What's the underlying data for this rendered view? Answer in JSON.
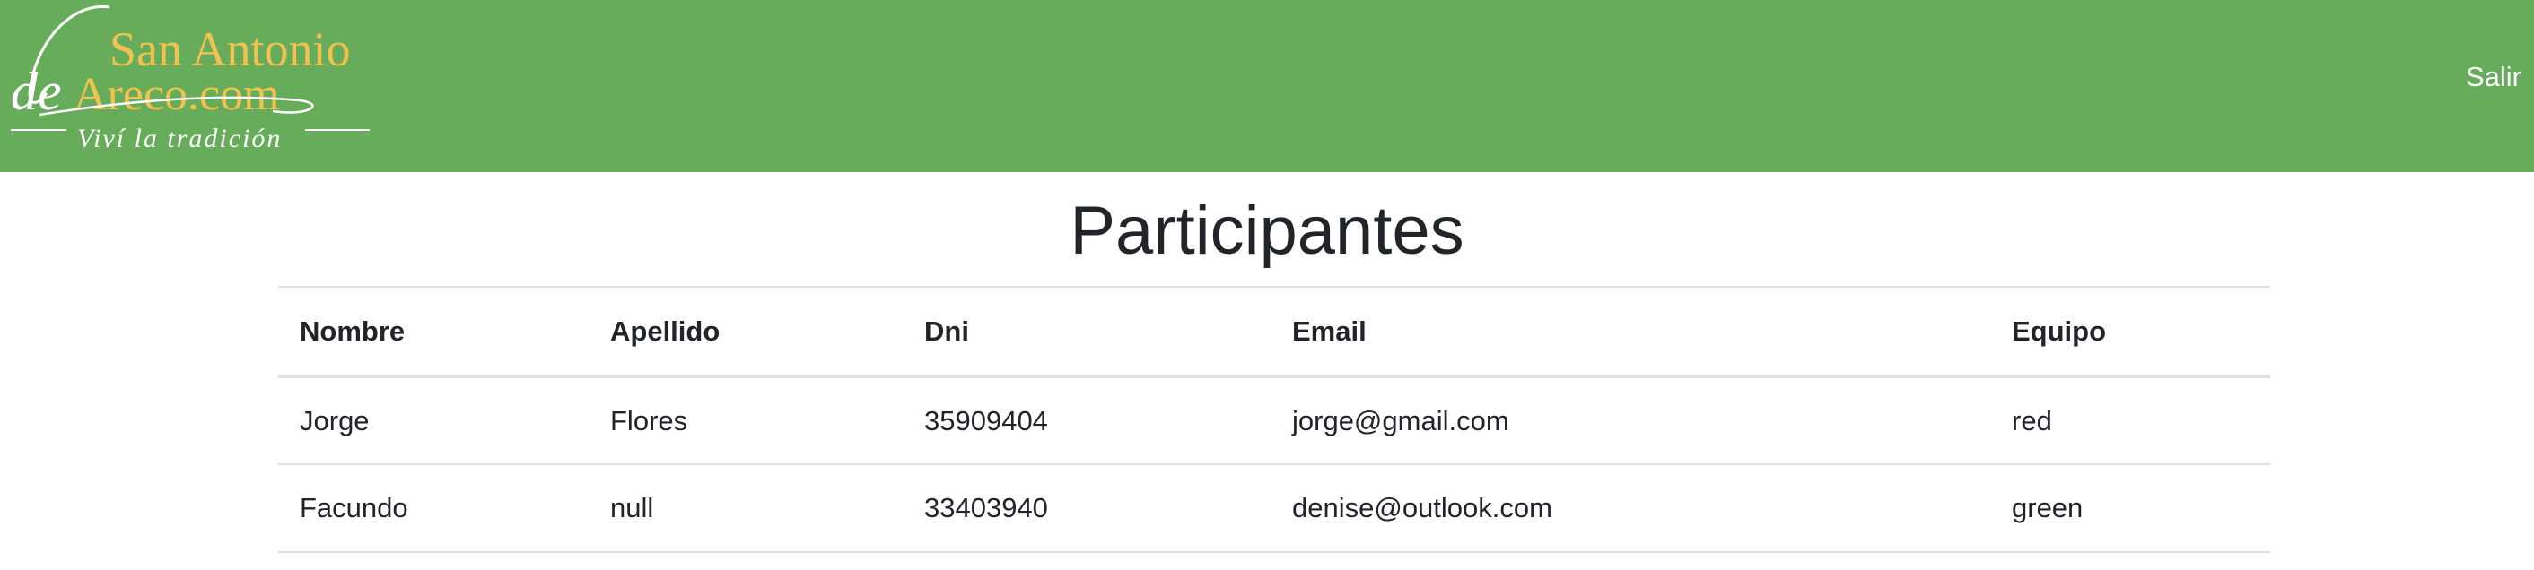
{
  "navbar": {
    "logo": {
      "line1": "San Antonio",
      "line2_script": "de",
      "line2": "Areco.com",
      "tagline": "Viví la tradición"
    },
    "logout_label": "Salir"
  },
  "page": {
    "title": "Participantes"
  },
  "table": {
    "headers": [
      "Nombre",
      "Apellido",
      "Dni",
      "Email",
      "Equipo"
    ],
    "rows": [
      [
        "Jorge",
        "Flores",
        "35909404",
        "jorge@gmail.com",
        "red"
      ],
      [
        "Facundo",
        "null",
        "33403940",
        "denise@outlook.com",
        "green"
      ]
    ]
  },
  "colors": {
    "navbar_bg": "#67ac5b",
    "logo_gold": "#f2c24f",
    "text": "#212529",
    "border": "#dee2e6"
  }
}
